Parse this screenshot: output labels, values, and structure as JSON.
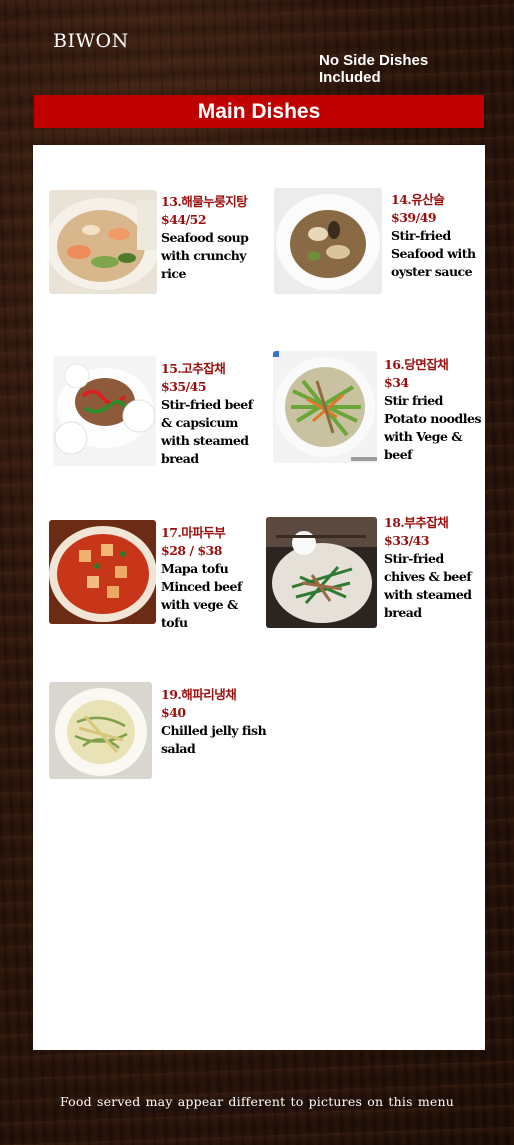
{
  "header": {
    "brand": "BIWON",
    "note": "No Side Dishes Included",
    "section_title": "Main Dishes"
  },
  "dishes": [
    {
      "name": "13.해물누룽지탕",
      "price": "$44/52",
      "desc": "Seafood soup\nwith crunchy\nrice",
      "photo_icon": "seafood-soup-photo"
    },
    {
      "name": "14.유산슬",
      "price": "$39/49",
      "desc": "Stir-fried\nSeafood with\noyster sauce",
      "photo_icon": "stir-fried-seafood-photo"
    },
    {
      "name": "15.고추잡채",
      "price": "$35/45",
      "desc": "Stir-fried beef\n& capsicum\nwith steamed\nbread",
      "photo_icon": "beef-capsicum-photo"
    },
    {
      "name": "16.당면잡채",
      "price": "$34",
      "desc": "Stir fried\nPotato noodles\nwith Vege &\nbeef",
      "photo_icon": "potato-noodles-photo"
    },
    {
      "name": "17.마파두부",
      "price": "$28 / $38",
      "desc": "Mapa tofu\nMinced beef\nwith vege &\ntofu",
      "photo_icon": "mapo-tofu-photo"
    },
    {
      "name": "18.부추잡채",
      "price": "$33/43",
      "desc": "Stir-fried\nchives & beef\nwith steamed\nbread",
      "photo_icon": "chives-beef-photo"
    },
    {
      "name": "19.해파리냉채",
      "price": "$40",
      "desc": "Chilled jelly fish\nsalad",
      "photo_icon": "jellyfish-salad-photo"
    }
  ],
  "footer": {
    "disclaimer": "Food served may appear different  to pictures on this menu"
  },
  "colors": {
    "banner": "#c00000",
    "dish_name": "#9b0e0e",
    "panel": "#ffffff"
  }
}
